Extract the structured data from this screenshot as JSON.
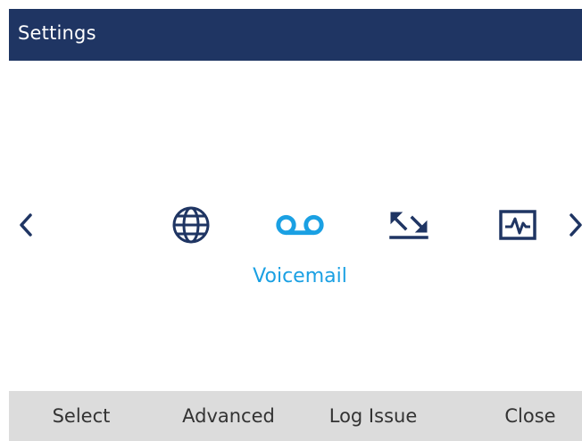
{
  "header": {
    "title": "Settings",
    "bg_color": "#1f3563",
    "text_color": "#ffffff"
  },
  "carousel": {
    "prev_icon": "chevron-left-icon",
    "next_icon": "chevron-right-icon",
    "items": [
      {
        "icon": "globe-icon",
        "selected": false
      },
      {
        "icon": "voicemail-icon",
        "selected": true
      },
      {
        "icon": "call-history-icon",
        "selected": false
      },
      {
        "icon": "diagnostics-icon",
        "selected": false
      }
    ],
    "selected_label": "Voicemail",
    "accent_color": "#1aa0e3",
    "icon_color": "#1f3563"
  },
  "softkeys": {
    "select": "Select",
    "advanced": "Advanced",
    "log_issue": "Log Issue",
    "close": "Close",
    "bg_color": "#dcdcdc"
  }
}
